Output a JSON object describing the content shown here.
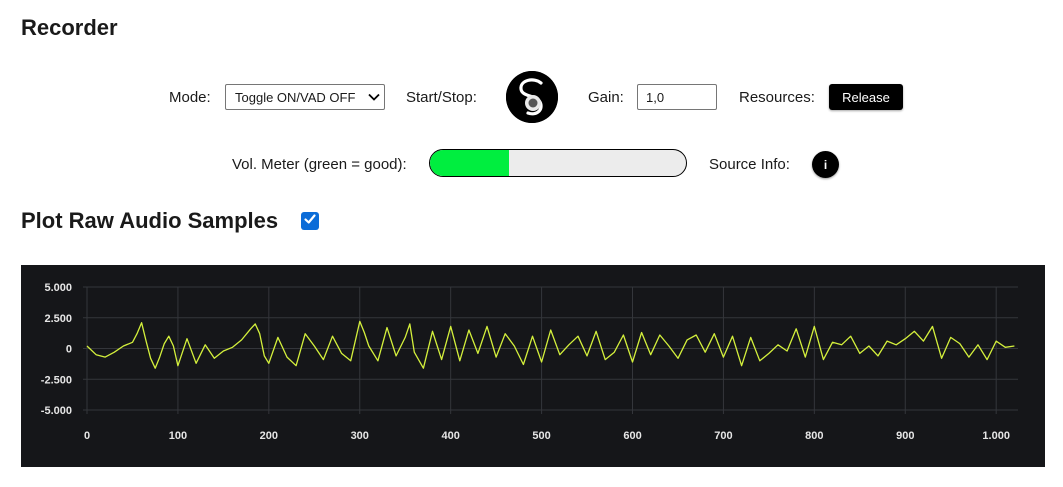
{
  "recorder": {
    "title": "Recorder",
    "mode_label": "Mode:",
    "mode_value": "Toggle ON/VAD OFF",
    "startstop_label": "Start/Stop:",
    "gain_label": "Gain:",
    "gain_value": "1,0",
    "resources_label": "Resources:",
    "release_label": "Release",
    "vol_label": "Vol. Meter (green = good):",
    "vol_level": 0.31,
    "vol_color": "#00ee3f",
    "source_label": "Source Info:",
    "info_glyph": "i",
    "icons": {
      "record": "recorder-logo-icon",
      "select": "chevron-down-icon",
      "checkbox": "checkmark-icon"
    }
  },
  "plot": {
    "title": "Plot Raw Audio Samples",
    "checked": true,
    "checkbox_color": "#0b6cd8"
  },
  "chart_data": {
    "type": "line",
    "title": "",
    "xlabel": "",
    "ylabel": "",
    "xlim": [
      0,
      1024
    ],
    "ylim": [
      -5000,
      5000
    ],
    "x_ticks": [
      0,
      100,
      200,
      300,
      400,
      500,
      600,
      700,
      800,
      900,
      1000
    ],
    "x_tick_labels": [
      "0",
      "100",
      "200",
      "300",
      "400",
      "500",
      "600",
      "700",
      "800",
      "900",
      "1.000"
    ],
    "y_ticks": [
      5000,
      2500,
      0,
      -2500,
      -5000
    ],
    "y_tick_labels": [
      "5.000",
      "2.500",
      "0",
      "-2.500",
      "-5.000"
    ],
    "grid": true,
    "background": "#151619",
    "line_color": "#d4f03c",
    "series": [
      {
        "x": [
          0,
          10,
          20,
          30,
          40,
          50,
          55,
          60,
          65,
          70,
          75,
          80,
          85,
          90,
          95,
          100,
          110,
          120,
          130,
          140,
          150,
          160,
          170,
          180,
          185,
          190,
          195,
          200,
          210,
          220,
          230,
          240,
          250,
          260,
          270,
          280,
          290,
          300,
          305,
          310,
          320,
          330,
          340,
          350,
          355,
          360,
          370,
          380,
          390,
          400,
          410,
          420,
          430,
          440,
          450,
          460,
          470,
          480,
          490,
          500,
          510,
          520,
          530,
          540,
          550,
          560,
          570,
          580,
          590,
          600,
          610,
          620,
          630,
          640,
          650,
          660,
          670,
          680,
          690,
          700,
          710,
          720,
          730,
          740,
          750,
          760,
          770,
          780,
          790,
          800,
          810,
          820,
          830,
          840,
          850,
          860,
          870,
          880,
          890,
          900,
          910,
          920,
          930,
          940,
          950,
          960,
          970,
          980,
          990,
          1000,
          1010,
          1020
        ],
        "y": [
          200,
          -500,
          -700,
          -300,
          200,
          500,
          1200,
          2100,
          600,
          -800,
          -1600,
          -700,
          400,
          1000,
          200,
          -1400,
          800,
          -1200,
          300,
          -800,
          -200,
          100,
          700,
          1600,
          2000,
          1200,
          -600,
          -1200,
          900,
          -700,
          -1400,
          1200,
          200,
          -900,
          1000,
          -400,
          -1000,
          2200,
          1300,
          200,
          -1000,
          1700,
          -600,
          900,
          2000,
          -300,
          -1600,
          1400,
          -900,
          1800,
          -1000,
          1500,
          -400,
          1800,
          -700,
          1200,
          200,
          -1300,
          1000,
          -1100,
          1500,
          -500,
          300,
          1000,
          -600,
          1400,
          -900,
          -300,
          1100,
          -1100,
          1300,
          -500,
          1100,
          200,
          -800,
          700,
          1100,
          -300,
          1200,
          -700,
          1000,
          -1400,
          900,
          -1000,
          -400,
          300,
          -200,
          1600,
          -700,
          1800,
          -900,
          500,
          300,
          1000,
          -400,
          200,
          -600,
          600,
          300,
          800,
          1400,
          600,
          1800,
          -800,
          900,
          400,
          -700,
          300,
          -900,
          600,
          100,
          200
        ]
      }
    ]
  }
}
